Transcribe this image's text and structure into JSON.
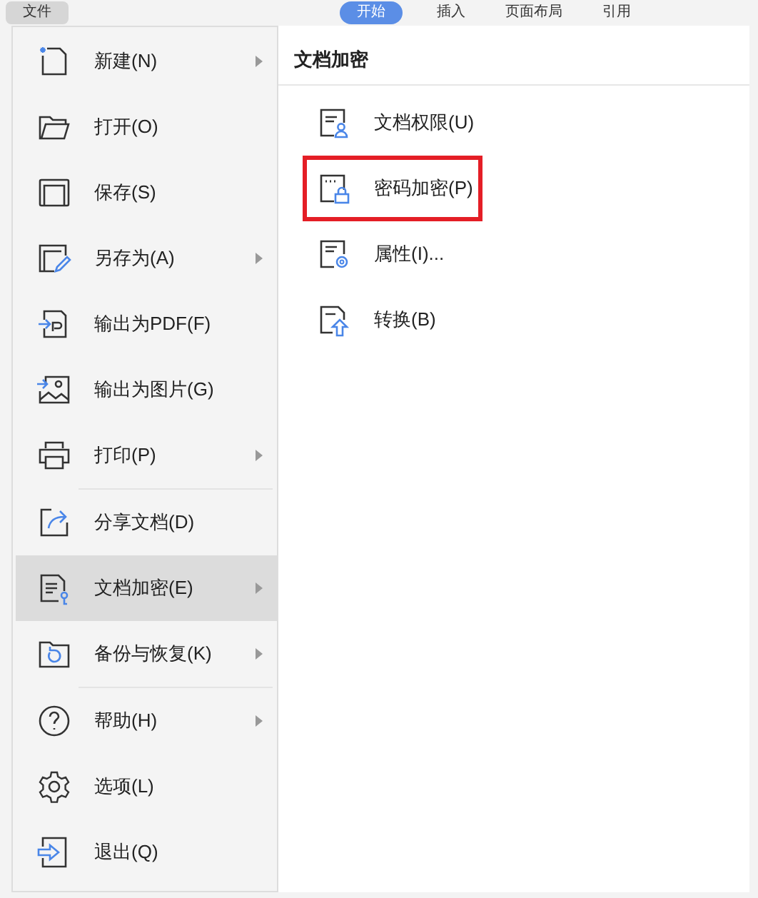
{
  "toolbar": {
    "file_button": "文件",
    "tabs": [
      {
        "label": "开始",
        "selected": true
      },
      {
        "label": "插入",
        "selected": false
      },
      {
        "label": "页面布局",
        "selected": false
      },
      {
        "label": "引用",
        "selected": false
      }
    ]
  },
  "menu": {
    "items": [
      {
        "label": "新建(N)",
        "submenu": true,
        "selected": false
      },
      {
        "label": "打开(O)",
        "submenu": false,
        "selected": false
      },
      {
        "label": "保存(S)",
        "submenu": false,
        "selected": false
      },
      {
        "label": "另存为(A)",
        "submenu": true,
        "selected": false
      },
      {
        "label": "输出为PDF(F)",
        "submenu": false,
        "selected": false
      },
      {
        "label": "输出为图片(G)",
        "submenu": false,
        "selected": false
      },
      {
        "label": "打印(P)",
        "submenu": true,
        "selected": false,
        "divider_after": true
      },
      {
        "label": "分享文档(D)",
        "submenu": false,
        "selected": false
      },
      {
        "label": "文档加密(E)",
        "submenu": true,
        "selected": true
      },
      {
        "label": "备份与恢复(K)",
        "submenu": true,
        "selected": false,
        "divider_after": true
      },
      {
        "label": "帮助(H)",
        "submenu": true,
        "selected": false
      },
      {
        "label": "选项(L)",
        "submenu": false,
        "selected": false
      },
      {
        "label": "退出(Q)",
        "submenu": false,
        "selected": false
      }
    ]
  },
  "submenu": {
    "title": "文档加密",
    "items": [
      {
        "label": "文档权限(U)",
        "highlighted": false
      },
      {
        "label": "密码加密(P)",
        "highlighted": true
      },
      {
        "label": "属性(I)...",
        "highlighted": false
      },
      {
        "label": "转换(B)",
        "highlighted": false
      }
    ]
  }
}
